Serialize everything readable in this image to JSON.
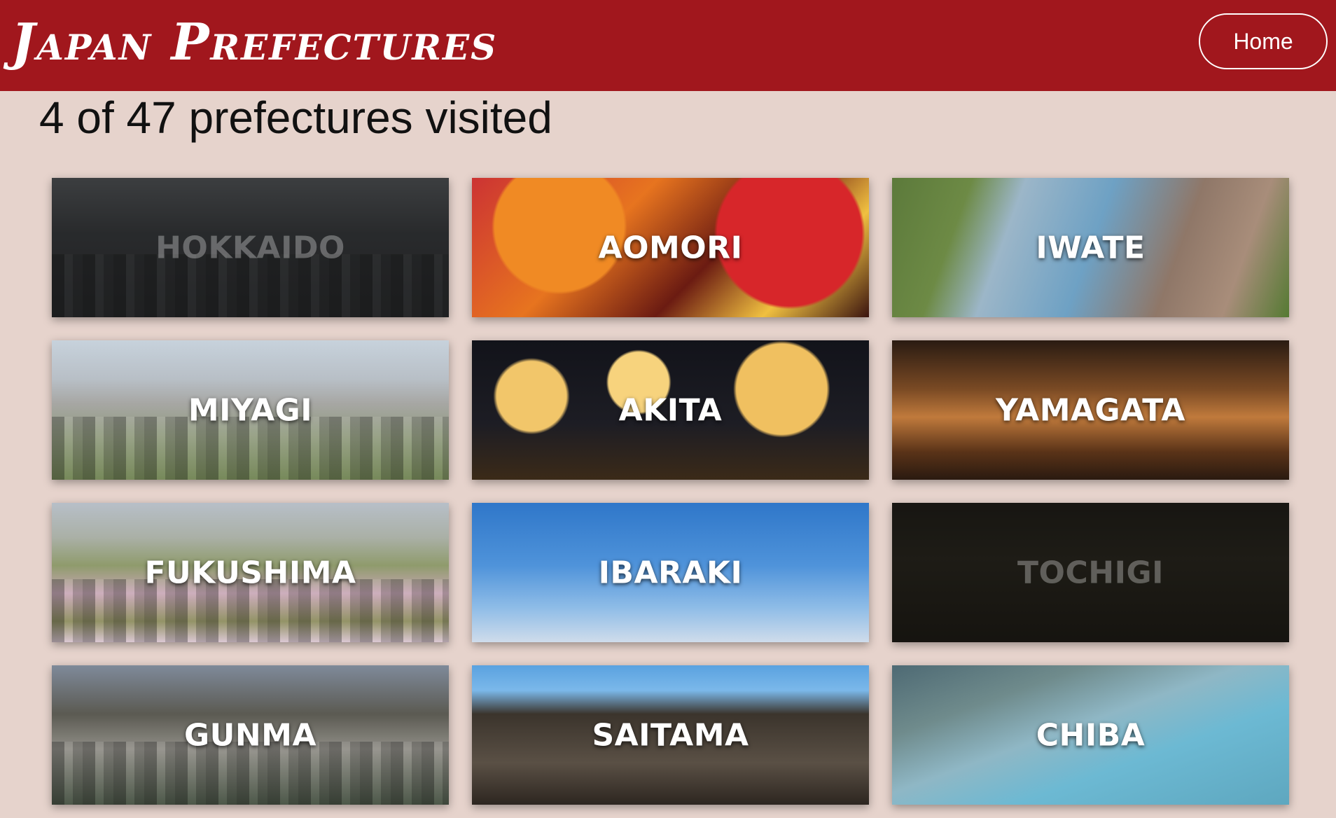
{
  "header": {
    "brand": "Japan Prefectures",
    "home_label": "Home"
  },
  "summary": {
    "visited_text": "4 of 47 prefectures visited"
  },
  "prefectures": [
    {
      "name": "HOKKAIDO",
      "visited": false
    },
    {
      "name": "AOMORI",
      "visited": true
    },
    {
      "name": "IWATE",
      "visited": true
    },
    {
      "name": "MIYAGI",
      "visited": true
    },
    {
      "name": "AKITA",
      "visited": true
    },
    {
      "name": "YAMAGATA",
      "visited": true
    },
    {
      "name": "FUKUSHIMA",
      "visited": true
    },
    {
      "name": "IBARAKI",
      "visited": true
    },
    {
      "name": "TOCHIGI",
      "visited": false
    },
    {
      "name": "GUNMA",
      "visited": true
    },
    {
      "name": "SAITAMA",
      "visited": true
    },
    {
      "name": "CHIBA",
      "visited": true
    }
  ],
  "colors": {
    "header_bg": "#a1171d",
    "page_bg": "#e6d3cc"
  }
}
